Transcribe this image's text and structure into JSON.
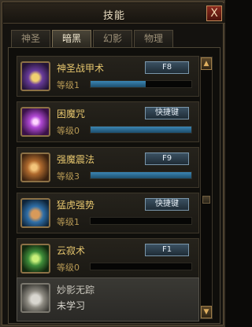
{
  "window": {
    "title": "技能",
    "close_label": "X"
  },
  "tabs": [
    {
      "label": "神圣",
      "active": false
    },
    {
      "label": "暗黑",
      "active": true
    },
    {
      "label": "幻影",
      "active": false
    },
    {
      "label": "物理",
      "active": false
    }
  ],
  "skills": [
    {
      "name": "神圣战甲术",
      "level": "等级1",
      "hotkey": "F8",
      "progress": 0.55,
      "icon": "holy-armor-icon",
      "color": "#7a4bb0"
    },
    {
      "name": "困魔咒",
      "level": "等级0",
      "hotkey": "快捷键",
      "progress": 1.0,
      "icon": "trap-demon-icon",
      "color": "#8a3aa8"
    },
    {
      "name": "强魔震法",
      "level": "等级3",
      "hotkey": "F9",
      "progress": 1.0,
      "icon": "force-blast-icon",
      "color": "#a66a2a"
    },
    {
      "name": "猛虎强势",
      "level": "等级1",
      "hotkey": "快捷键",
      "progress": 0.0,
      "icon": "tiger-fist-icon",
      "color": "#2a7ab0"
    },
    {
      "name": "云寂术",
      "level": "等级0",
      "hotkey": "F1",
      "progress": 0.0,
      "icon": "cloud-leaf-icon",
      "color": "#3f8e3a"
    }
  ],
  "unlearned": {
    "name": "妙影无踪",
    "state": "未学习",
    "icon": "shadow-stealth-icon"
  },
  "scroll": {
    "up": "▲",
    "down": "▼"
  }
}
